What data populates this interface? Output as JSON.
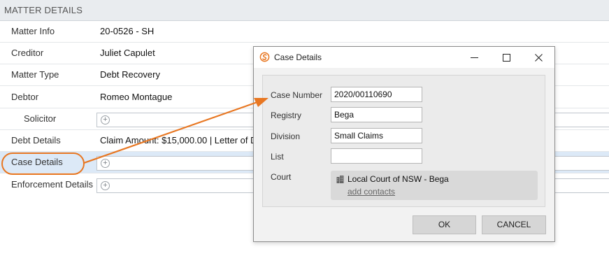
{
  "section": {
    "title": "MATTER DETAILS"
  },
  "rows": [
    {
      "label": "Matter Info",
      "value": "20-0526 - SH"
    },
    {
      "label": "Creditor",
      "value": "Juliet Capulet"
    },
    {
      "label": "Matter Type",
      "value": "Debt Recovery"
    },
    {
      "label": "Debtor",
      "value": "Romeo Montague"
    },
    {
      "label": "Solicitor",
      "value": ""
    },
    {
      "label": "Debt Details",
      "value": "Claim Amount: $15,000.00 | Letter of D"
    },
    {
      "label": "Case Details",
      "value": ""
    },
    {
      "label": "Enforcement Details",
      "value": ""
    }
  ],
  "dialog": {
    "title": "Case Details",
    "fields": [
      {
        "label": "Case Number",
        "value": "2020/00110690"
      },
      {
        "label": "Registry",
        "value": "Bega"
      },
      {
        "label": "Division",
        "value": "Small Claims"
      },
      {
        "label": "List",
        "value": ""
      }
    ],
    "court_label": "Court",
    "court_name": "Local Court of NSW - Bega",
    "court_link": "add contacts",
    "ok_label": "OK",
    "cancel_label": "CANCEL"
  },
  "colors": {
    "accent": "#e87722",
    "selected_row": "#dce9f7",
    "header_bg": "#e9ecef"
  }
}
